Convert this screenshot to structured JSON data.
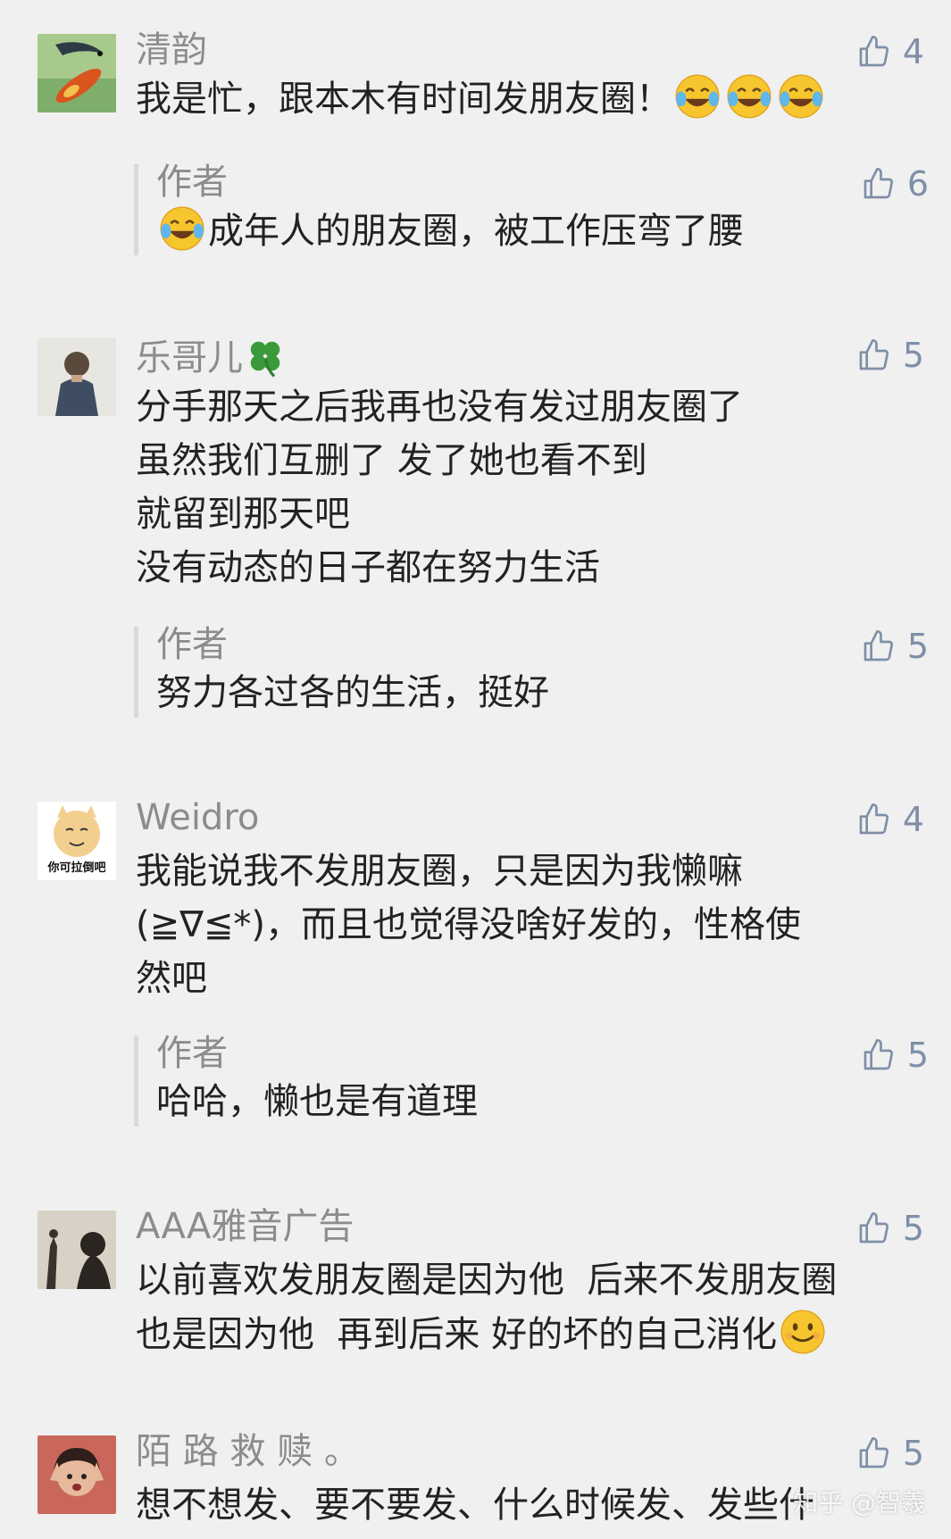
{
  "comments": [
    {
      "username": "清韵",
      "likes": "4",
      "text": "我是忙，跟本木有时间发朋友圈！",
      "emoji_suffix": [
        "laugh-cry-emoji",
        "laugh-cry-emoji",
        "laugh-cry-emoji"
      ],
      "reply": {
        "username": "作者",
        "likes": "6",
        "emoji_prefix": "laugh-cry-emoji",
        "text": "成年人的朋友圈，被工作压弯了腰"
      }
    },
    {
      "username": "乐哥儿",
      "username_icon": "four-leaf-clover-emoji",
      "likes": "5",
      "text": "分手那天之后我再也没有发过朋友圈了\n虽然我们互删了 发了她也看不到\n就留到那天吧\n没有动态的日子都在努力生活",
      "reply": {
        "username": "作者",
        "likes": "5",
        "text": "努力各过各的生活，挺好"
      }
    },
    {
      "username": "Weidro",
      "avatar_caption": "你可拉倒吧",
      "likes": "4",
      "text": "我能说我不发朋友圈，只是因为我懒嘛\n(≧∇≦*)，而且也觉得没啥好发的，性格使\n然吧",
      "reply": {
        "username": "作者",
        "likes": "5",
        "text": "哈哈，懒也是有道理"
      }
    },
    {
      "username": "AAA雅音广告",
      "likes": "5",
      "text": "以前喜欢发朋友圈是因为他  后来不发朋友圈\n也是因为他  再到后来 好的坏的自己消化",
      "emoji_suffix": [
        "smile-emoji"
      ]
    },
    {
      "username": "陌 路 救 赎 。",
      "likes": "5",
      "text": "想不想发、要不要发、什么时候发、发些什"
    }
  ],
  "watermark": "知乎 @智羲",
  "colors": {
    "background": "#f0f0f0",
    "text": "#222222",
    "username": "#8c8c8c",
    "like": "#7f8fa8",
    "reply_bar": "#d9d9d9"
  }
}
